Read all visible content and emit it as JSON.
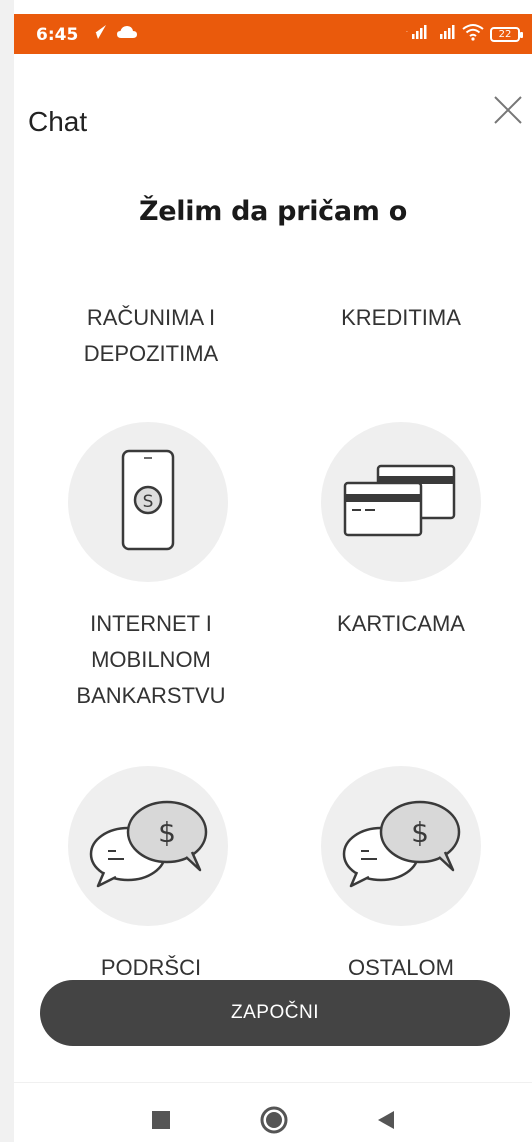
{
  "status_bar": {
    "time": "6:45",
    "battery": "22",
    "icons": [
      "signal-icon",
      "signal-icon",
      "wifi-icon",
      "battery-icon",
      "paper-plane-icon",
      "cloud-icon"
    ],
    "color": "#ea5a0c"
  },
  "header": {
    "title": "Chat",
    "close_icon": "close-icon"
  },
  "heading": "Želim da pričam o",
  "topics": [
    {
      "label": "RAČUNIMA I DEPOZITIMA",
      "icon": ""
    },
    {
      "label": "KREDITIMA",
      "icon": ""
    },
    {
      "label": "INTERNET I MOBILNOM BANKARSTVU",
      "icon": "mobile-payment-icon"
    },
    {
      "label": "KARTICAMA",
      "icon": "credit-cards-icon"
    },
    {
      "label": "PODRŠCI",
      "icon": "chat-bubbles-dollar-icon"
    },
    {
      "label": "OSTALOM",
      "icon": "chat-bubbles-dollar-icon"
    }
  ],
  "start_button": {
    "label": "ZAPOČNI",
    "color": "#444444"
  },
  "nav_bar": {
    "icons": [
      "recents-square-icon",
      "home-circle-icon",
      "back-triangle-icon"
    ]
  }
}
